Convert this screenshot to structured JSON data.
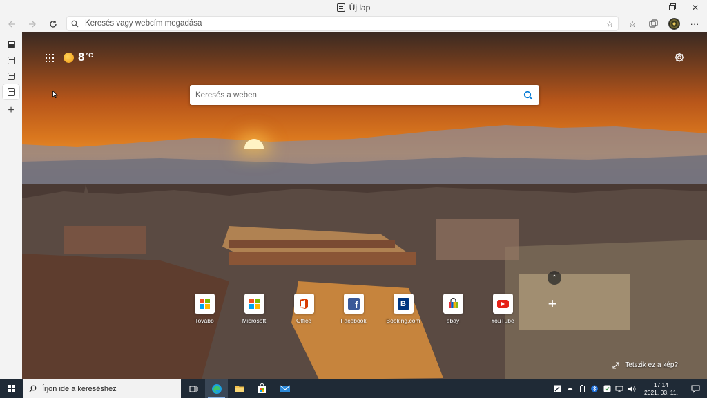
{
  "window": {
    "tab_title": "Új lap"
  },
  "addressbar": {
    "placeholder": "Keresés vagy webcím megadása"
  },
  "newtab": {
    "weather": {
      "temp": "8",
      "unit": "°C"
    },
    "search_placeholder": "Keresés a weben",
    "quick_links": [
      {
        "label": "Tovább",
        "icon": "microsoft-logo"
      },
      {
        "label": "Microsoft",
        "icon": "microsoft-logo"
      },
      {
        "label": "Office",
        "icon": "office-logo"
      },
      {
        "label": "Facebook",
        "icon": "facebook-logo"
      },
      {
        "label": "Booking.com",
        "icon": "booking-logo"
      },
      {
        "label": "ebay",
        "icon": "ebay-logo"
      },
      {
        "label": "YouTube",
        "icon": "youtube-logo"
      }
    ],
    "like_image": "Tetszik ez a kép?"
  },
  "taskbar": {
    "search_placeholder": "Írjon ide a kereséshez",
    "time": "17:14",
    "date": "2021. 03. 11."
  },
  "colors": {
    "edge_blue": "#0078d4",
    "taskbar": "#1f2a36"
  }
}
